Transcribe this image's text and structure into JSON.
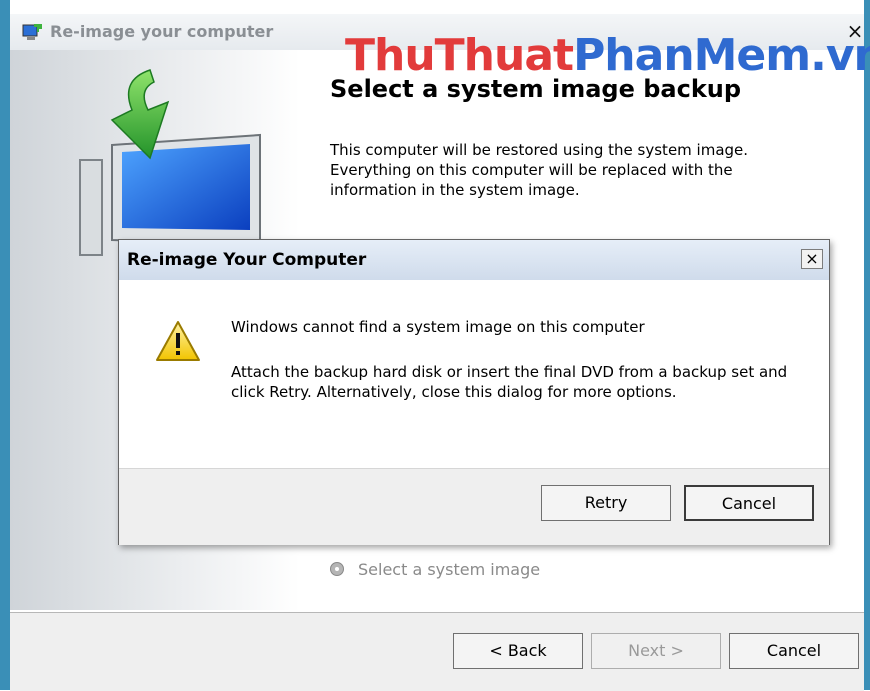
{
  "window": {
    "title": "Re-image your computer",
    "close_glyph": "×"
  },
  "watermark": {
    "part1": "ThuThuat",
    "part2": "PhanMem.vn"
  },
  "main": {
    "heading": "Select a system image backup",
    "description": "This computer will be restored using the system image. Everything on this computer will be replaced with the information in the system image.",
    "radio_label": "Select a system image"
  },
  "footer": {
    "back_label": "< Back",
    "next_label": "Next >",
    "cancel_label": "Cancel"
  },
  "dialog": {
    "title": "Re-image Your Computer",
    "close_glyph": "×",
    "message_title": "Windows cannot find a system image on this computer",
    "message_body": "Attach the backup hard disk or insert the final DVD from a backup set and click Retry. Alternatively, close this dialog for more options.",
    "retry_label": "Retry",
    "cancel_label": "Cancel"
  },
  "icons": [
    "restore-computer-icon",
    "warning-icon",
    "radio-icon"
  ],
  "colors": {
    "frame": "#3a8fb7",
    "watermark_red": "#e23b3b",
    "watermark_blue": "#2f6ad0",
    "dialog_title_bg": "#cfdbeb",
    "footer_bg": "#efefef"
  }
}
